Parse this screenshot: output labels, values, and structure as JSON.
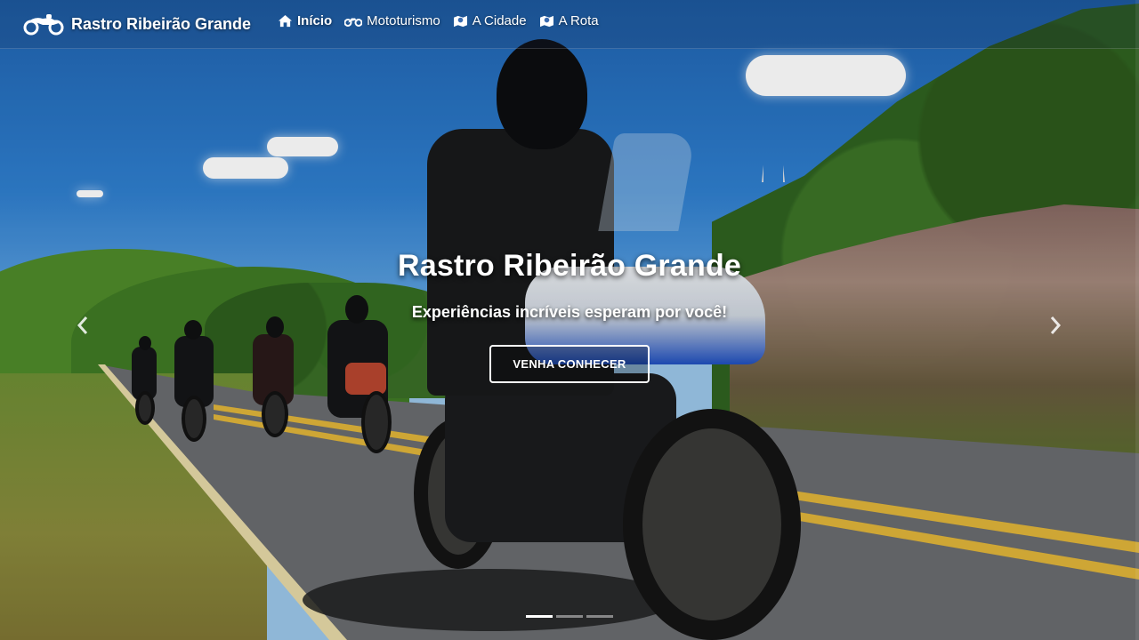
{
  "navbar": {
    "brand": "Rastro Ribeirão Grande",
    "brand_icon": "motorcycle-icon",
    "links": [
      {
        "label": "Início",
        "icon": "home-icon",
        "active": true
      },
      {
        "label": "Mototurismo",
        "icon": "motorcycle-icon",
        "active": false
      },
      {
        "label": "A Cidade",
        "icon": "map-marker-icon",
        "active": false
      },
      {
        "label": "A Rota",
        "icon": "map-marker-icon",
        "active": false
      }
    ]
  },
  "carousel": {
    "title": "Rastro Ribeirão Grande",
    "subtitle": "Experiências incríveis esperam por você!",
    "cta_label": "VENHA CONHECER",
    "prev_icon": "chevron-left-icon",
    "next_icon": "chevron-right-icon",
    "slide_count": 3,
    "active_slide": 1
  },
  "colors": {
    "text": "#ffffff",
    "road_line": "#e0b53a",
    "fairing_accent": "#1f4fbf"
  }
}
